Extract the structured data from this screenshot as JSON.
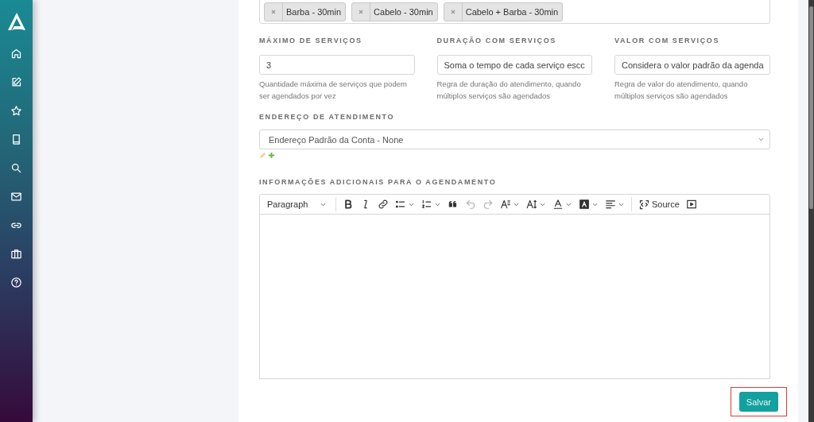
{
  "services": {
    "tags": [
      {
        "label": "Barba - 30min"
      },
      {
        "label": "Cabelo - 30min"
      },
      {
        "label": "Cabelo + Barba - 30min"
      }
    ]
  },
  "fields": [
    {
      "label": "MÁXIMO DE SERVIÇOS",
      "value": "3",
      "help": "Quantidade máxima de serviços que podem ser agendados por vez"
    },
    {
      "label": "DURAÇÃO COM SERVIÇOS",
      "value": "Soma o tempo de cada serviço escc",
      "help": "Regra de duração do atendimento, quando múltiplos serviços são agendados"
    },
    {
      "label": "VALOR COM SERVIÇOS",
      "value": "Considera o valor padrão da agenda",
      "help": "Regra de valor do atendimento, quando múltiplos serviços são agendados"
    }
  ],
  "address": {
    "label": "ENDEREÇO DE ATENDIMENTO",
    "value": "Endereço Padrão da Conta - None"
  },
  "editor": {
    "label": "INFORMAÇÕES ADICIONAIS PARA O AGENDAMENTO",
    "toolbar": [
      {
        "kind": "heading",
        "label": "Paragraph",
        "disabled": false
      },
      {
        "kind": "bold",
        "disabled": false
      },
      {
        "kind": "italic",
        "disabled": false
      },
      {
        "kind": "link",
        "disabled": false
      },
      {
        "kind": "bulleted",
        "disabled": false
      },
      {
        "kind": "numbered",
        "disabled": false
      },
      {
        "kind": "quote",
        "disabled": false
      },
      {
        "kind": "undo",
        "disabled": true
      },
      {
        "kind": "redo",
        "disabled": true
      },
      {
        "kind": "fontfamily",
        "disabled": false
      },
      {
        "kind": "fontsize",
        "disabled": false
      },
      {
        "kind": "fontcolor",
        "disabled": false
      },
      {
        "kind": "bgcolor",
        "disabled": false
      },
      {
        "kind": "align",
        "disabled": false
      },
      {
        "kind": "source",
        "label": "Source",
        "disabled": false
      },
      {
        "kind": "media",
        "disabled": false
      }
    ]
  },
  "save_button": {
    "label": "Salvar",
    "highlighted": true
  }
}
